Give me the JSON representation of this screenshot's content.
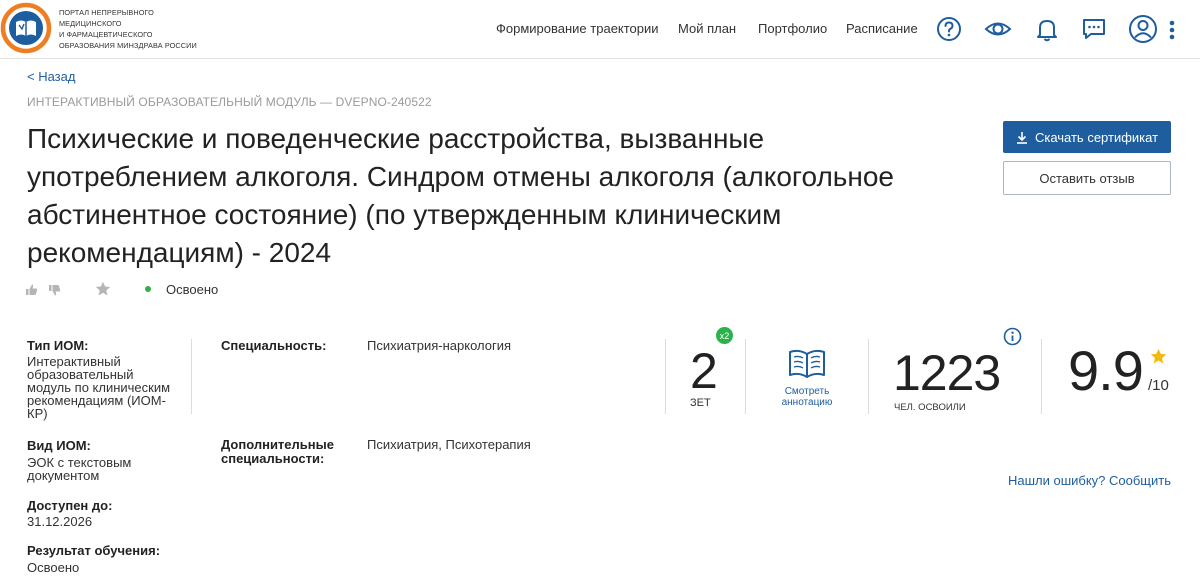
{
  "header": {
    "logo_lines": [
      "ПОРТАЛ НЕПРЕРЫВНОГО",
      "МЕДИЦИНСКОГО",
      "И ФАРМАЦЕВТИЧЕСКОГО",
      "ОБРАЗОВАНИЯ МИНЗДРАВА РОССИИ"
    ],
    "nav": [
      "Формирование траектории",
      "Мой план",
      "Портфолио",
      "Расписание"
    ],
    "icons": [
      "help-icon",
      "eye-icon",
      "bell-icon",
      "chat-icon",
      "profile-icon",
      "more-vertical-icon"
    ]
  },
  "back_label": "< Назад",
  "module_code": "ИНТЕРАКТИВНЫЙ ОБРАЗОВАТЕЛЬНЫЙ МОДУЛЬ — DVEPNO-240522",
  "title": "Психические и поведенческие расстройства, вызванные употреблением алкоголя. Синдром отмены алкоголя (алкогольное абстинентное состояние) (по утвержденным клиническим рекомендациям) - 2024",
  "actions": {
    "download_label": "Скачать сертификат",
    "review_label": "Оставить отзыв"
  },
  "status": {
    "label": "Освоено",
    "color": "#2bb24c"
  },
  "info_left": [
    {
      "label": "Тип ИОМ:",
      "value": "Интерактивный образовательный модуль по клиническим рекомендациям (ИОМ-КР)"
    },
    {
      "label": "Вид ИОМ:",
      "value": "ЭОК с текстовым документом"
    },
    {
      "label": "Доступен до:",
      "value": "31.12.2026"
    },
    {
      "label": "Результат обучения:",
      "value": "Освоено"
    }
  ],
  "specialty": {
    "label": "Специальность:",
    "value": "Психиатрия-наркология"
  },
  "additional_specialty": {
    "label": "Дополнительные специальности:",
    "value": "Психиатрия, Психотерапия"
  },
  "stats": {
    "zet_value": "2",
    "zet_badge": "x2",
    "zet_label": "ЗЕТ",
    "annotation_label": "Смотреть аннотацию",
    "learners_value": "1223",
    "learners_label": "ЧЕЛ. ОСВОИЛИ",
    "rating_value": "9.9",
    "rating_max": "/10"
  },
  "report_error": "Нашли ошибку? Сообщить",
  "colors": {
    "accent": "#1f5e9e",
    "success": "#2bb24c",
    "star": "#f5b80b",
    "logo_orange": "#ef7d22"
  }
}
